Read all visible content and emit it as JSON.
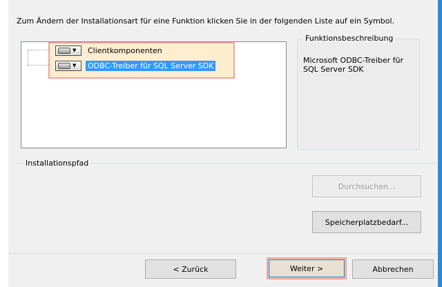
{
  "instruction": "Zum Ändern der Installationsart für eine Funktion klicken Sie in der folgenden Liste auf ein Symbol.",
  "tree": {
    "items": [
      {
        "label": "Clientkomponenten",
        "icon": "drive-icon",
        "selected": false
      },
      {
        "label": "ODBC-Treiber für SQL Server SDK",
        "icon": "drive-icon",
        "selected": true
      }
    ]
  },
  "feature_description": {
    "legend": "Funktionsbeschreibung",
    "text": "Microsoft ODBC-Treiber für SQL Server SDK"
  },
  "install_path": {
    "legend": "Installationspfad",
    "browse_label": "Durchsuchen...",
    "disk_cost_label": "Speicherplatzbedarf..."
  },
  "footer": {
    "back_label": "< Zurück",
    "next_label": "Weiter >",
    "cancel_label": "Abbrechen"
  },
  "colors": {
    "selection": "#3399ff",
    "accent_edge": "#2b89d8"
  }
}
